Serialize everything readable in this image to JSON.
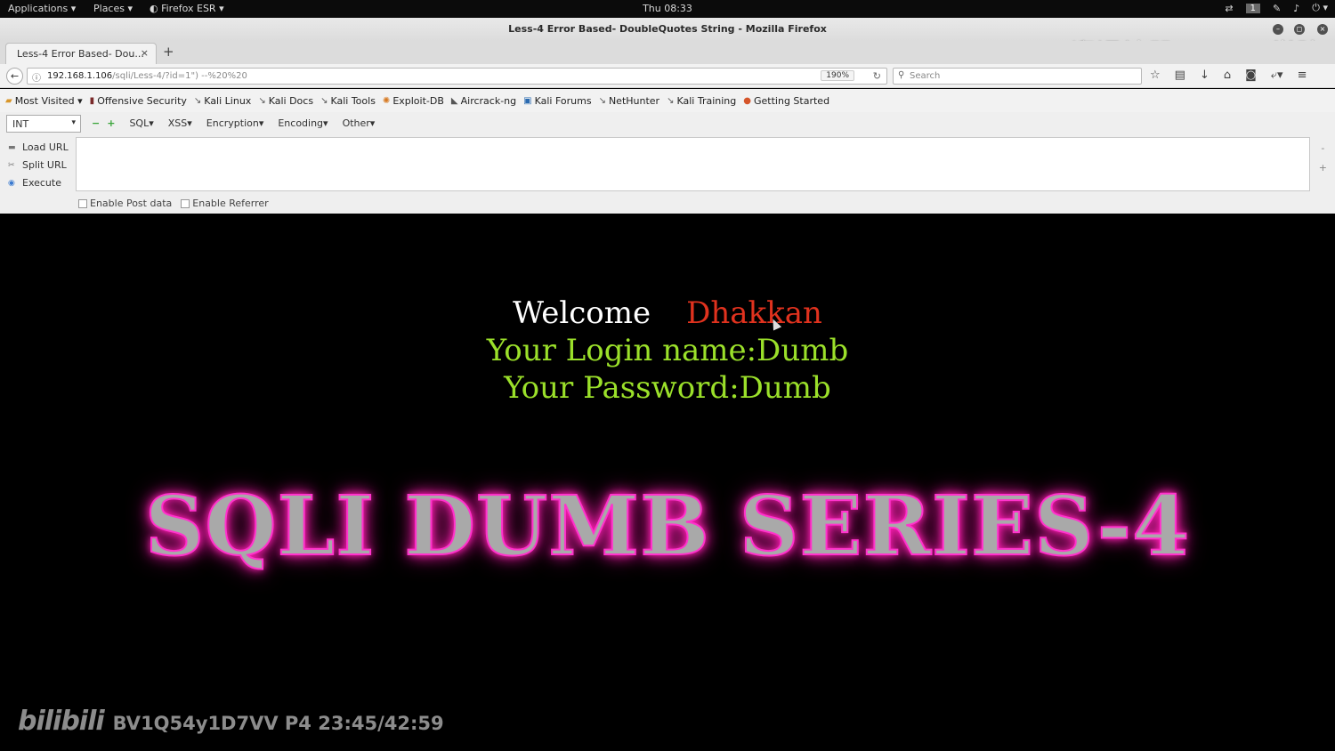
{
  "topbar": {
    "applications": "Applications ▾",
    "places": "Places ▾",
    "firefox": "◐ Firefox ESR ▾",
    "clock": "Thu 08:33",
    "workspace": "1"
  },
  "window": {
    "title": "Less-4 Error Based- DoubleQuotes String - Mozilla Firefox",
    "watermark": "溜课神器 51CTO学院"
  },
  "tab": {
    "label": "Less-4 Error Based- Dou...",
    "close": "×",
    "new": "+"
  },
  "nav": {
    "url_host": "192.168.1.106",
    "url_path": "/sqli/Less-4/?id=1\") --%20%20",
    "zoom": "190%",
    "search_placeholder": "Search"
  },
  "bookmarks": [
    "Most Visited ▾",
    "Offensive Security",
    "Kali Linux",
    "Kali Docs",
    "Kali Tools",
    "Exploit-DB",
    "Aircrack-ng",
    "Kali Forums",
    "NetHunter",
    "Kali Training",
    "Getting Started"
  ],
  "hackbar": {
    "select_value": "INT",
    "menus": [
      "SQL▾",
      "XSS▾",
      "Encryption▾",
      "Encoding▾",
      "Other▾"
    ],
    "load_url": "Load URL",
    "split_url": "Split URL",
    "execute": "Execute",
    "enable_post": "Enable Post data",
    "enable_referrer": "Enable Referrer"
  },
  "page": {
    "welcome": "Welcome",
    "name": "Dhakkan",
    "login_line": "Your Login name:Dumb",
    "password_line": "Your Password:Dumb",
    "banner": "SQLI DUMB SERIES-4"
  },
  "overlay": {
    "logo": "bilibili",
    "video_info": "BV1Q54y1D7VV P4 23:45/42:59"
  },
  "colors": {
    "welcome": "#ffffff",
    "name": "#e0321e",
    "credentials": "#9be02a",
    "banner_glow": "#ff1fb4"
  }
}
